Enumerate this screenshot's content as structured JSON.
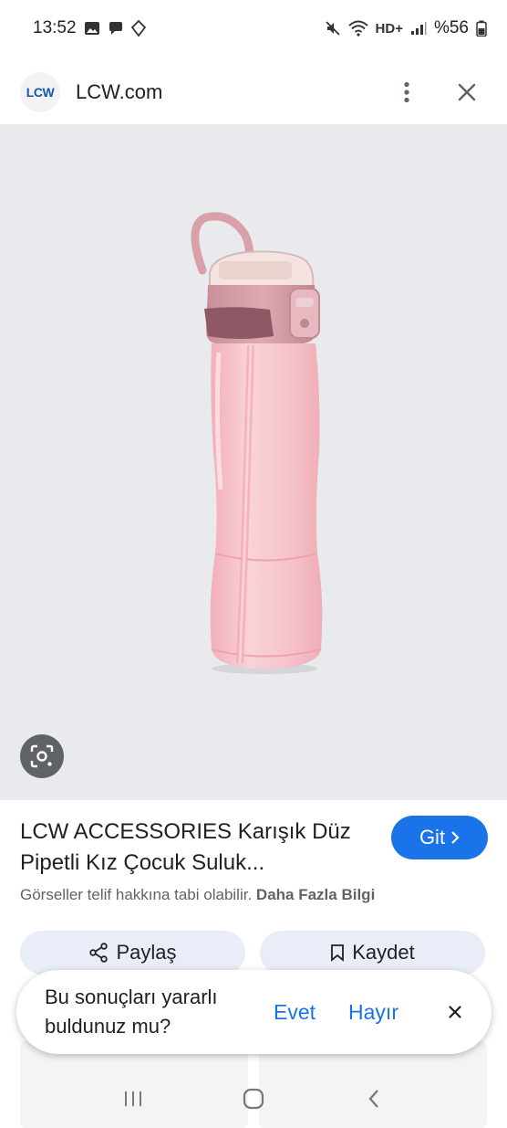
{
  "status_bar": {
    "time": "13:52",
    "battery_text": "%56",
    "network_text": "HD+",
    "icons": [
      "image-icon",
      "chat-icon",
      "gem-icon",
      "mute-icon",
      "wifi-icon",
      "signal-icon",
      "battery-icon"
    ]
  },
  "header": {
    "logo_text": "LCW",
    "site_name": "LCW.com"
  },
  "product": {
    "title": "LCW ACCESSORIES Karışık Düz Pipetli Kız Çocuk Suluk...",
    "go_label": "Git",
    "copyright_text": "Görseller telif hakkına tabi olabilir.",
    "more_info_label": "Daha Fazla Bilgi"
  },
  "actions": {
    "share_label": "Paylaş",
    "save_label": "Kaydet"
  },
  "feedback": {
    "question": "Bu sonuçları yararlı buldunuz mu?",
    "yes_label": "Evet",
    "no_label": "Hayır"
  },
  "colors": {
    "accent": "#1a73e8",
    "image_bg": "#e9eaee",
    "bottle_pink": "#f6bcc4",
    "cap_mauve": "#c98f99"
  }
}
